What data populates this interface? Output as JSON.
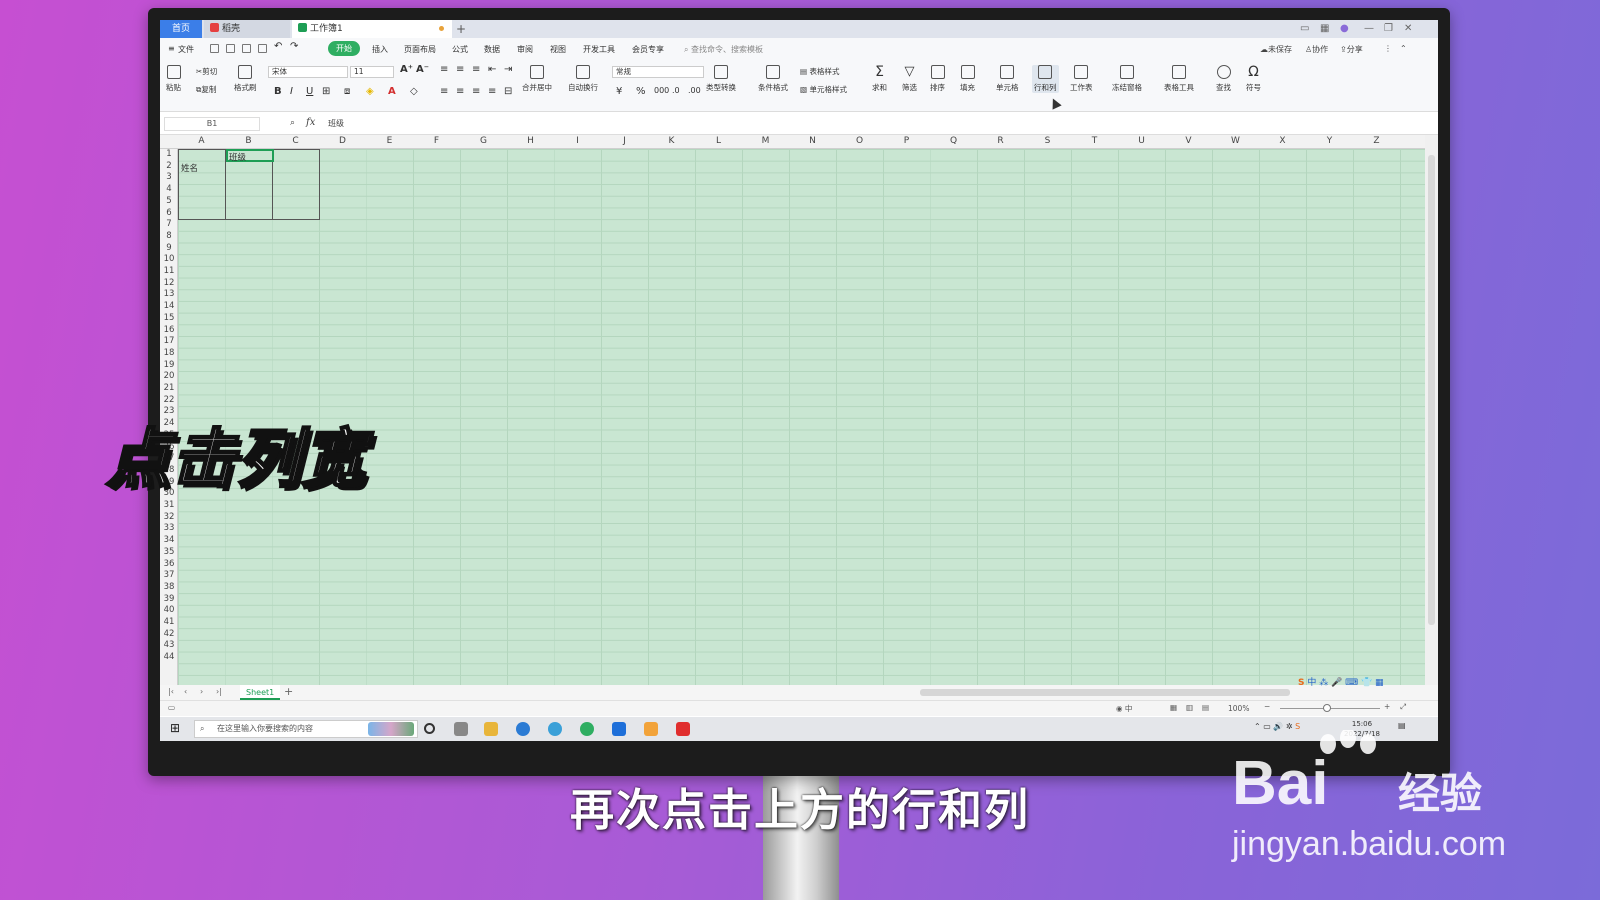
{
  "titlebar": {
    "tab_home": "首页",
    "tab_doc": "稻壳",
    "tab_workbook": "工作簿1",
    "tab_add": "+"
  },
  "menubar": {
    "file": "文件",
    "items": [
      "开始",
      "插入",
      "页面布局",
      "公式",
      "数据",
      "审阅",
      "视图",
      "开发工具",
      "会员专享"
    ],
    "search_placeholder": "查找命令、搜索模板",
    "unsaved": "未保存",
    "collab": "协作",
    "share": "分享"
  },
  "ribbon": {
    "paste": "粘贴",
    "cut": "剪切",
    "copy": "复制",
    "format_painter": "格式刷",
    "font_name": "宋体",
    "font_size": "11",
    "merge_center": "合并居中",
    "wrap_text": "自动换行",
    "number_format": "常规",
    "type_convert": "类型转换",
    "conditional_format": "条件格式",
    "table_style": "表格样式",
    "cell_style": "单元格样式",
    "sum": "求和",
    "filter": "筛选",
    "sort": "排序",
    "fill": "填充",
    "cell": "单元格",
    "row_col": "行和列",
    "worksheet": "工作表",
    "freeze": "冻结窗格",
    "table_tools": "表格工具",
    "find": "查找",
    "symbol": "符号"
  },
  "formula_bar": {
    "cell_ref": "B1",
    "fx": "fx",
    "content": "班级"
  },
  "grid": {
    "columns": [
      "A",
      "B",
      "C",
      "D",
      "E",
      "F",
      "G",
      "H",
      "I",
      "J",
      "K",
      "L",
      "M",
      "N",
      "O",
      "P",
      "Q",
      "R",
      "S",
      "T",
      "U",
      "V",
      "W",
      "X",
      "Y",
      "Z"
    ],
    "rows": [
      "1",
      "2",
      "3",
      "4",
      "5",
      "6",
      "7",
      "8",
      "9",
      "10",
      "11",
      "12",
      "13",
      "14",
      "15",
      "16",
      "17",
      "18",
      "19",
      "20",
      "21",
      "22",
      "23",
      "24",
      "25",
      "26",
      "27",
      "28",
      "29",
      "30",
      "31",
      "32",
      "33",
      "34",
      "35",
      "36",
      "37",
      "38",
      "39",
      "40",
      "41",
      "42",
      "43",
      "44"
    ],
    "cell_B1": "班级",
    "cell_A2": "姓名"
  },
  "sheets": {
    "active": "Sheet1",
    "add": "+"
  },
  "status": {
    "zoom": "100%"
  },
  "taskbar": {
    "search_placeholder": "在这里输入你要搜索的内容",
    "time": "15:06",
    "date": "2022/7/18"
  },
  "overlay": {
    "headline": "点击列宽",
    "subtitle": "再次点击上方的行和列"
  },
  "watermark": {
    "brand": "Bai",
    "brand_cn": "经验",
    "url": "jingyan.baidu.com"
  },
  "colors": {
    "accent": "#2fae62",
    "cell_fill": "#c9e6d2",
    "background_start": "#c64fd2",
    "background_end": "#7b6bd9"
  }
}
